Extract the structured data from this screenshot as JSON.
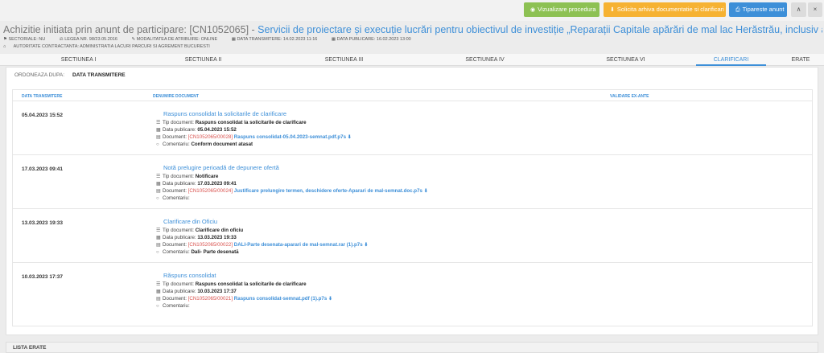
{
  "toolbar": {
    "view_label": "Vizualizare procedura",
    "archive_label": "Solicita arhiva documentatie si clarificari",
    "print_label": "Tipareste anunt",
    "collapse_glyph": "∧",
    "close_glyph": "×"
  },
  "header": {
    "title_prefix": "Achizitie initiata prin anunt de participare: [CN1052065] - ",
    "title_main": "Servicii de proiectare și execuție lucrări pentru obiectivul de investiție „Reparații Capitale apărări de mal lac Herăstrău, inclusiv apărări de mal insule Her…",
    "meta": [
      "SECTORIALE: NU",
      "LEGEA NR. 98/23.05.2016",
      "MODALITATEA DE ATRIBUIRE: ONLINE",
      "DATA TRANSMITERE: 14.02.2023 11:16",
      "DATA PUBLICARE: 16.02.2023 13:00"
    ],
    "authority": "AUTORITATE CONTRACTANTA: ADMINISTRATIA LACURI PARCURI SI AGREMENT BUCURESTI"
  },
  "tabs": [
    "SECTIUNEA I",
    "SECTIUNEA II",
    "SECTIUNEA III",
    "SECTIUNEA IV",
    "SECTIUNEA VI",
    "CLARIFICARI",
    "ERATE"
  ],
  "order": {
    "label": "ORDONEAZA DUPA:",
    "value": "DATA TRANSMITERE"
  },
  "columns": [
    "DATA TRANSMITERE",
    "DENUMIRE DOCUMENT",
    "VALIDARE EX-ANTE"
  ],
  "labels": {
    "type": "Tip document:",
    "published": "Data publicare:",
    "document": "Document:",
    "comments": "Comentariu:"
  },
  "rows": [
    {
      "date": "05.04.2023 15:52",
      "title": "Raspuns consolidat la solicitarile de clarificare",
      "type": "Raspuns consolidat la solicitarile de clarificare",
      "published": "05.04.2023 15:52",
      "doc_code": "[CN1052065/00028]",
      "doc_name": "Raspuns consolidat-05.04.2023-semnat.pdf.p7s",
      "comment": "Conform document atasat"
    },
    {
      "date": "17.03.2023 09:41",
      "title": "Notă prelugire perioadă de depunere ofertă",
      "type": "Notificare",
      "published": "17.03.2023 09:41",
      "doc_code": "[CN1052065/00024]",
      "doc_name": "Justificare prelungire termen, deschidere oferte-Aparari de mal-semnat.doc.p7s",
      "comment": ""
    },
    {
      "date": "13.03.2023 19:33",
      "title": "Clarificare din Oficiu",
      "type": "Clarificare din oficiu",
      "published": "13.03.2023 19:33",
      "doc_code": "[CN1052065/00022]",
      "doc_name": "DALI-Parte desenata-aparari de mal-semnat.rar (1).p7s",
      "comment": "Dali- Parte desenată"
    },
    {
      "date": "10.03.2023 17:37",
      "title": "Răspuns consolidat",
      "type": "Raspuns consolidat la solicitarile de clarificare",
      "published": "10.03.2023 17:37",
      "doc_code": "[CN1052065/00021]",
      "doc_name": "Raspuns consolidat-semnat.pdf (1).p7s",
      "comment": ""
    }
  ],
  "lista_erate": "LISTA ERATE"
}
